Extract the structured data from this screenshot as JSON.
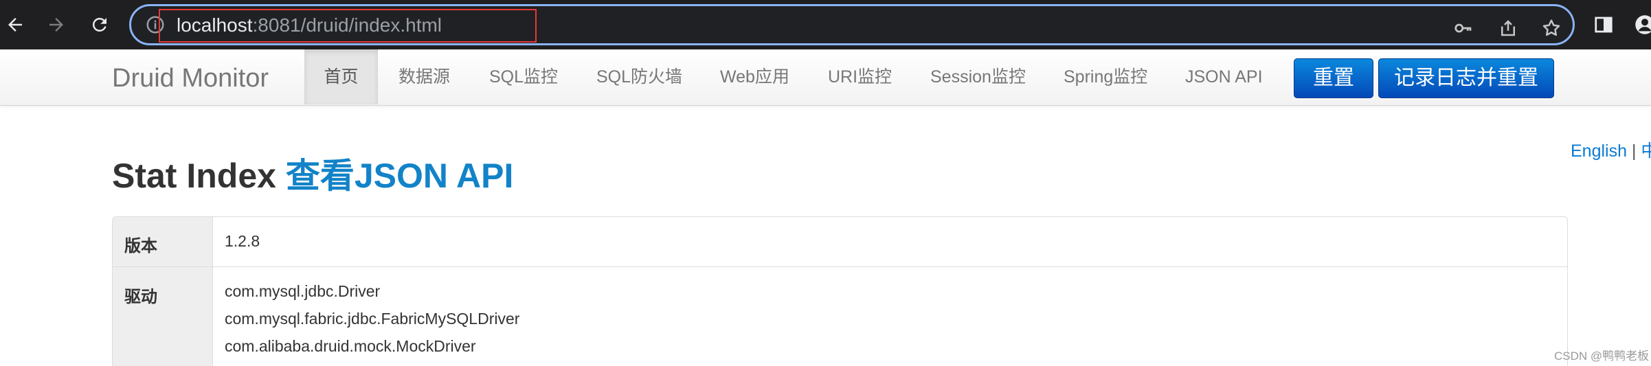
{
  "browser": {
    "url_host": "localhost",
    "url_rest": ":8081/druid/index.html"
  },
  "navbar": {
    "brand": "Druid Monitor",
    "items": [
      {
        "label": "首页",
        "active": true
      },
      {
        "label": "数据源"
      },
      {
        "label": "SQL监控"
      },
      {
        "label": "SQL防火墙"
      },
      {
        "label": "Web应用"
      },
      {
        "label": "URI监控"
      },
      {
        "label": "Session监控"
      },
      {
        "label": "Spring监控"
      },
      {
        "label": "JSON API"
      }
    ],
    "reset_label": "重置",
    "log_reset_label": "记录日志并重置"
  },
  "lang": {
    "english": "English",
    "separator": "|",
    "chinese": "中"
  },
  "page": {
    "title": "Stat Index",
    "json_link": "查看JSON API"
  },
  "table": {
    "version_key": "版本",
    "version_value": "1.2.8",
    "driver_key": "驱动",
    "drivers": [
      "com.mysql.jdbc.Driver",
      "com.mysql.fabric.jdbc.FabricMySQLDriver",
      "com.alibaba.druid.mock.MockDriver"
    ]
  },
  "watermark": "CSDN @鸭鸭老板",
  "colors": {
    "chrome_bg": "#1f1f21",
    "omnibox_border": "#8ab4f8",
    "highlight_box": "#e53935",
    "button_blue": "#0a6fd0",
    "link_blue": "#1283c8"
  }
}
